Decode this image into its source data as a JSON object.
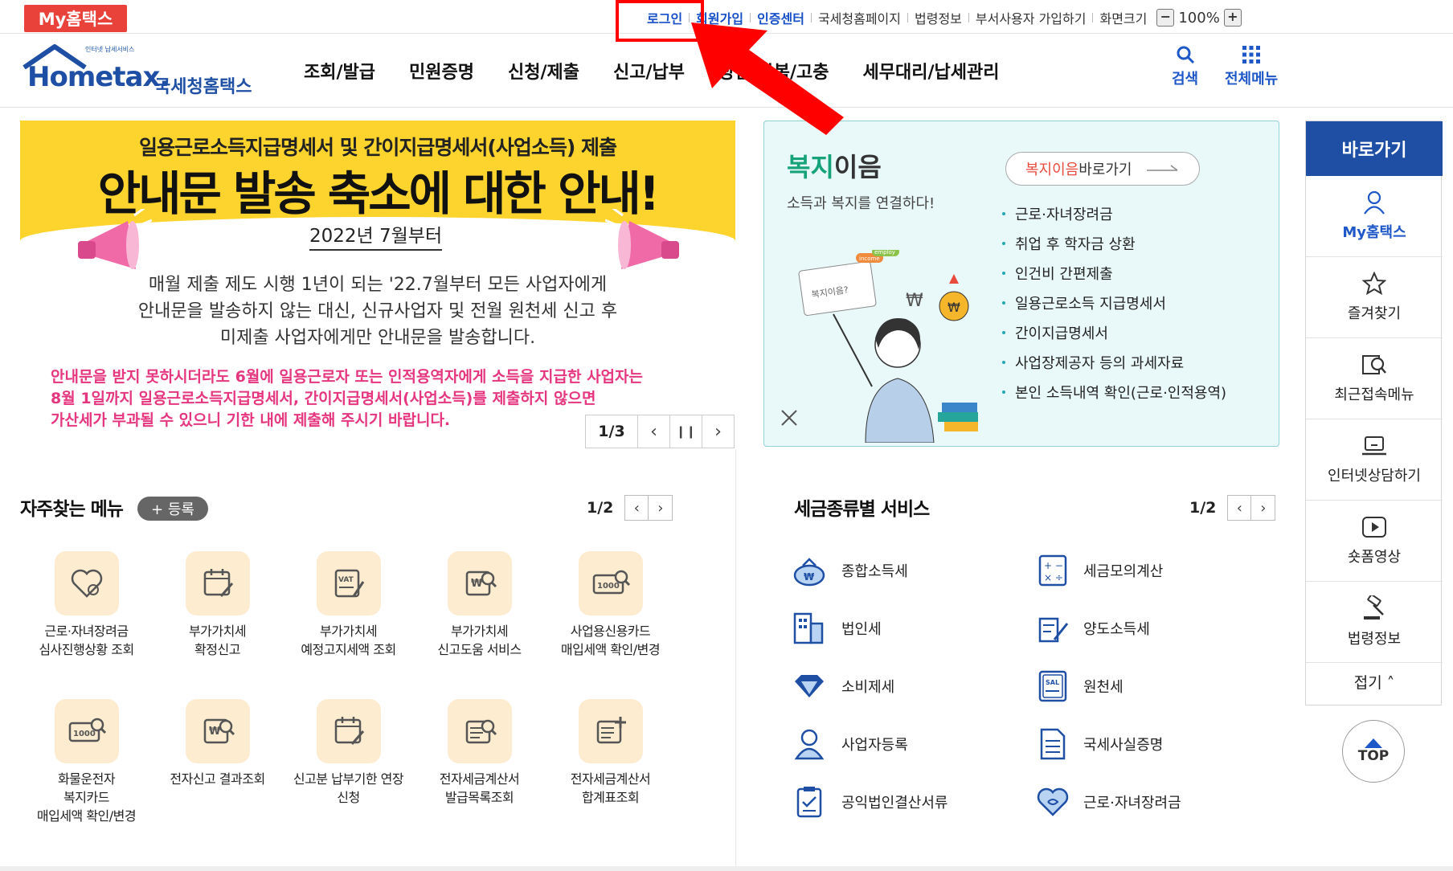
{
  "topbar": {
    "my_hometax": "My홈택스",
    "links": [
      {
        "label": "로그인",
        "highlight": true
      },
      {
        "label": "회원가입",
        "highlight": true
      },
      {
        "label": "인증센터",
        "highlight": true
      },
      {
        "label": "국세청홈페이지",
        "highlight": false
      },
      {
        "label": "법령정보",
        "highlight": false
      },
      {
        "label": "부서사용자 가입하기",
        "highlight": false
      },
      {
        "label": "화면크기",
        "highlight": false
      }
    ],
    "zoom_minus": "−",
    "zoom_value": "100%",
    "zoom_plus": "+"
  },
  "header": {
    "logo_sub": "인터넷 납세서비스",
    "logo_en": "Hometax.",
    "logo_ko": "국세청홈택스",
    "nav": [
      "조회/발급",
      "민원증명",
      "신청/제출",
      "신고/납부",
      "상담/불복/고충",
      "세무대리/납세관리"
    ],
    "search_label": "검색",
    "all_menu_label": "전체메뉴"
  },
  "banner": {
    "title_small": "일용근로소득지급명세서 및 간이지급명세서(사업소득) 제출",
    "title_big": "안내문 발송 축소에 대한 안내!",
    "date": "2022년 7월부터",
    "body": "매월 제출 제도 시행 1년이 되는 '22.7월부터 모든 사업자에게\n안내문을 발송하지 않는 대신, 신규사업자 및 전월 원천세 신고 후\n미제출 사업자에게만 안내문을 발송합니다.",
    "warning": "안내문을 받지 못하시더라도 6월에 일용근로자 또는 인적용역자에게 소득을 지급한 사업자는\n8월 1일까지 일용근로소득지급명세서, 간이지급명세서(사업소득)를 제출하지 않으면\n가산세가 부과될 수 있으니 기한 내에 제출해 주시기 바랍니다.",
    "page": "1/3",
    "prev": "‹",
    "pause": "❙❙",
    "next": "›"
  },
  "welfare": {
    "title_green": "복지",
    "title_rest": "이음",
    "subtitle": "소득과 복지를 연결하다!",
    "button_red": "복지이음",
    "button_rest": " 바로가기",
    "items": [
      "근로·자녀장려금",
      "취업 후 학자금 상환",
      "인건비 간편제출",
      "일용근로소득 지급명세서",
      "간이지급명세서",
      "사업장제공자 등의 과세자료",
      "본인 소득내역 확인(근로·인적용역)"
    ],
    "illus_bubble": "복지이음?",
    "illus_tag1": "employ",
    "illus_tag2": "income",
    "illus_coin": "₩"
  },
  "frequent": {
    "title": "자주찾는 메뉴",
    "register": "+ 등록",
    "page": "1/2",
    "items": [
      {
        "label": "근로·자녀장려금\n심사진행상황 조회",
        "icon": "heart-icon"
      },
      {
        "label": "부가가치세\n확정신고",
        "icon": "calendar-edit-icon"
      },
      {
        "label": "부가가치세\n예정고지세액 조회",
        "icon": "vat-doc-icon"
      },
      {
        "label": "부가가치세\n신고도움 서비스",
        "icon": "won-search-icon"
      },
      {
        "label": "사업용신용카드\n매입세액 확인/변경",
        "icon": "card-search-icon"
      },
      {
        "label": "화물운전자\n복지카드\n매입세액 확인/변경",
        "icon": "card-search-icon"
      },
      {
        "label": "전자신고 결과조회",
        "icon": "won-search-icon"
      },
      {
        "label": "신고분 납부기한 연장\n신청",
        "icon": "calendar-edit-icon"
      },
      {
        "label": "전자세금계산서\n발급목록조회",
        "icon": "doc-search-icon"
      },
      {
        "label": "전자세금계산서\n합계표조회",
        "icon": "doc-plus-icon"
      }
    ],
    "card_text": "1000",
    "vat_text": "VAT"
  },
  "tax_services": {
    "title": "세금종류별 서비스",
    "page": "1/2",
    "items": [
      {
        "label": "종합소득세",
        "icon": "money-bag-icon"
      },
      {
        "label": "세금모의계산",
        "icon": "calculator-icon"
      },
      {
        "label": "법인세",
        "icon": "building-icon"
      },
      {
        "label": "양도소득세",
        "icon": "doc-pen-icon"
      },
      {
        "label": "소비제세",
        "icon": "diamond-icon"
      },
      {
        "label": "원천세",
        "icon": "salary-doc-icon"
      },
      {
        "label": "사업자등록",
        "icon": "person-icon"
      },
      {
        "label": "국세사실증명",
        "icon": "document-icon"
      },
      {
        "label": "공익법인결산서류",
        "icon": "clipboard-icon"
      },
      {
        "label": "근로·자녀장려금",
        "icon": "heart-icon"
      }
    ],
    "salary_text": "SAL"
  },
  "quick": {
    "title": "바로가기",
    "items": [
      {
        "label": "My홈택스",
        "icon": "user-icon"
      },
      {
        "label": "즐겨찾기",
        "icon": "star-icon"
      },
      {
        "label": "최근접속메뉴",
        "icon": "recent-search-icon"
      },
      {
        "label": "인터넷상담하기",
        "icon": "laptop-icon"
      },
      {
        "label": "숏폼영상",
        "icon": "play-icon"
      },
      {
        "label": "법령정보",
        "icon": "gavel-icon"
      }
    ],
    "fold": "접기 ˄",
    "top": "TOP"
  },
  "colors": {
    "brand_blue": "#1e4fa5",
    "link_blue": "#1750c7",
    "banner_yellow": "#fdd42d",
    "welfare_green": "#17a37a",
    "warning_pink": "#e5367f",
    "highlight_red": "#ff0000"
  }
}
